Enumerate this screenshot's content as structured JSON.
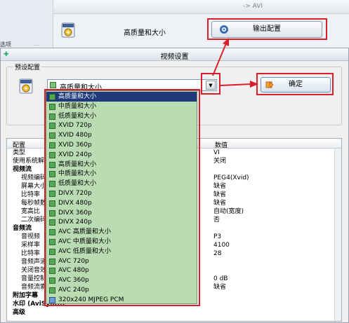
{
  "background_window": {
    "title_fragment": "-> AVI",
    "side_tabs": [
      "选项",
      "..."
    ],
    "preset_label": "高质量和大小",
    "output_button": "输出配置"
  },
  "dialog": {
    "title": "视频设置",
    "preset_group_label": "预设配置",
    "combo_value": "高质量和大小",
    "combo_arrow": "▼",
    "ok_button": "确定"
  },
  "grid": {
    "col_key": "配置",
    "col_value": "数值",
    "rows": [
      {
        "k": "类型",
        "v": "VI",
        "indent": false,
        "bold": false
      },
      {
        "k": "使用系统解...",
        "v": "关闭",
        "indent": false,
        "bold": false
      },
      {
        "k": "视频流",
        "v": "",
        "indent": false,
        "bold": true
      },
      {
        "k": "视频编码",
        "v": "PEG4(Xvid)",
        "indent": true,
        "bold": false
      },
      {
        "k": "屏幕大小",
        "v": "缺省",
        "indent": true,
        "bold": false
      },
      {
        "k": "比特率",
        "v": "缺省",
        "indent": true,
        "bold": false
      },
      {
        "k": "每秒帧数",
        "v": "缺省",
        "indent": true,
        "bold": false
      },
      {
        "k": "宽高比",
        "v": "自动(宽度)",
        "indent": true,
        "bold": false
      },
      {
        "k": "二次编码",
        "v": "否",
        "indent": true,
        "bold": false
      },
      {
        "k": "音频流",
        "v": "",
        "indent": false,
        "bold": true
      },
      {
        "k": "音视频",
        "v": "P3",
        "indent": true,
        "bold": false
      },
      {
        "k": "采样率",
        "v": "4100",
        "indent": true,
        "bold": false
      },
      {
        "k": "比特率",
        "v": "28",
        "indent": true,
        "bold": false
      },
      {
        "k": "音频声道",
        "v": "",
        "indent": true,
        "bold": false
      },
      {
        "k": "关闭音效",
        "v": "",
        "indent": true,
        "bold": false
      },
      {
        "k": "音量控制",
        "v": "0 dB",
        "indent": true,
        "bold": false
      },
      {
        "k": "音频流索引",
        "v": "缺省",
        "indent": true,
        "bold": false
      },
      {
        "k": "附加字幕",
        "v": "",
        "indent": false,
        "bold": true
      },
      {
        "k": "水印 (AviSynth)",
        "v": "",
        "indent": false,
        "bold": true
      },
      {
        "k": "高级",
        "v": "",
        "indent": false,
        "bold": true
      }
    ]
  },
  "dropdown": {
    "items": [
      {
        "label": "高质量和大小",
        "icon": "green",
        "selected": true
      },
      {
        "label": "中质量和大小",
        "icon": "green",
        "selected": false
      },
      {
        "label": "低质量和大小",
        "icon": "green",
        "selected": false
      },
      {
        "label": "XVID 720p",
        "icon": "green",
        "selected": false
      },
      {
        "label": "XVID 480p",
        "icon": "green",
        "selected": false
      },
      {
        "label": "XVID 360p",
        "icon": "green",
        "selected": false
      },
      {
        "label": "XVID 240p",
        "icon": "green",
        "selected": false
      },
      {
        "label": "高质量和大小",
        "icon": "green",
        "selected": false
      },
      {
        "label": "中质量和大小",
        "icon": "green",
        "selected": false
      },
      {
        "label": "低质量和大小",
        "icon": "green",
        "selected": false
      },
      {
        "label": "DIVX 720p",
        "icon": "green",
        "selected": false
      },
      {
        "label": "DIVX 480p",
        "icon": "green",
        "selected": false
      },
      {
        "label": "DIVX 360p",
        "icon": "green",
        "selected": false
      },
      {
        "label": "DIVX 240p",
        "icon": "green",
        "selected": false
      },
      {
        "label": "AVC 高质量和大小",
        "icon": "green",
        "selected": false
      },
      {
        "label": "AVC 中质量和大小",
        "icon": "green",
        "selected": false
      },
      {
        "label": "AVC 低质量和大小",
        "icon": "green",
        "selected": false
      },
      {
        "label": "AVC 720p",
        "icon": "green",
        "selected": false
      },
      {
        "label": "AVC 480p",
        "icon": "green",
        "selected": false
      },
      {
        "label": "AVC 360p",
        "icon": "green",
        "selected": false
      },
      {
        "label": "AVC 240p",
        "icon": "green",
        "selected": false
      },
      {
        "label": "320x240 MJPEG PCM",
        "icon": "blue",
        "selected": false
      }
    ]
  },
  "colors": {
    "highlight": "#d8202b",
    "dropdown_bg": "#b9dcb3",
    "selection": "#1f3a7a"
  }
}
